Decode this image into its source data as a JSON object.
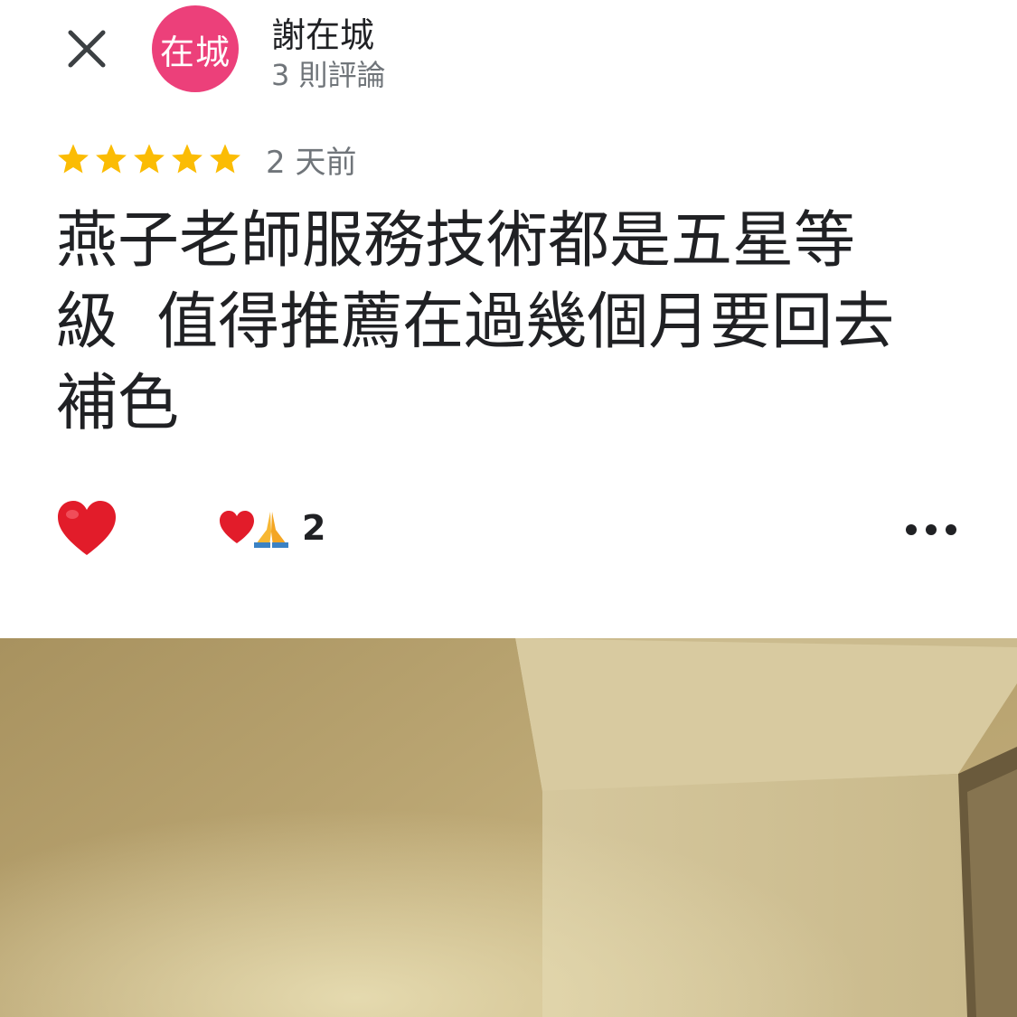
{
  "header": {
    "close_icon": "close-icon",
    "avatar_text": "在城",
    "avatar_color": "#ec407a",
    "user_name": "謝在城",
    "review_count": "3 則評論"
  },
  "review": {
    "rating": 5,
    "max_rating": 5,
    "star_color": "#fbbc04",
    "date": "2 天前",
    "text": "燕子老師服務技術都是五星等\n級  值得推薦在過幾個月要回去\n補色"
  },
  "reactions": {
    "like_icon": "heart-icon",
    "summary_icons": [
      "heart-icon",
      "folded-hands-icon"
    ],
    "count": "2",
    "more_icon": "more-options-icon"
  },
  "photo": {
    "description_colors": [
      "#b9a271",
      "#d7c79a",
      "#8a7548"
    ]
  }
}
